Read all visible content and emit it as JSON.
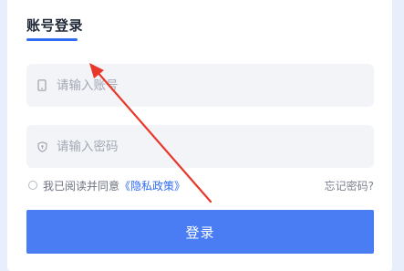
{
  "tab": {
    "title": "账号登录"
  },
  "account": {
    "placeholder": "请输入账号"
  },
  "password": {
    "placeholder": "请输入密码"
  },
  "agreement": {
    "prefix": "我已阅读并同意",
    "link": "《隐私政策》",
    "forgot": "忘记密码?"
  },
  "login": {
    "label": "登录"
  },
  "colors": {
    "accent": "#2f6bf2",
    "button": "#4a7df3",
    "annotation": "#e8382c"
  },
  "icons": {
    "account": "phone-icon",
    "password": "shield-icon"
  }
}
